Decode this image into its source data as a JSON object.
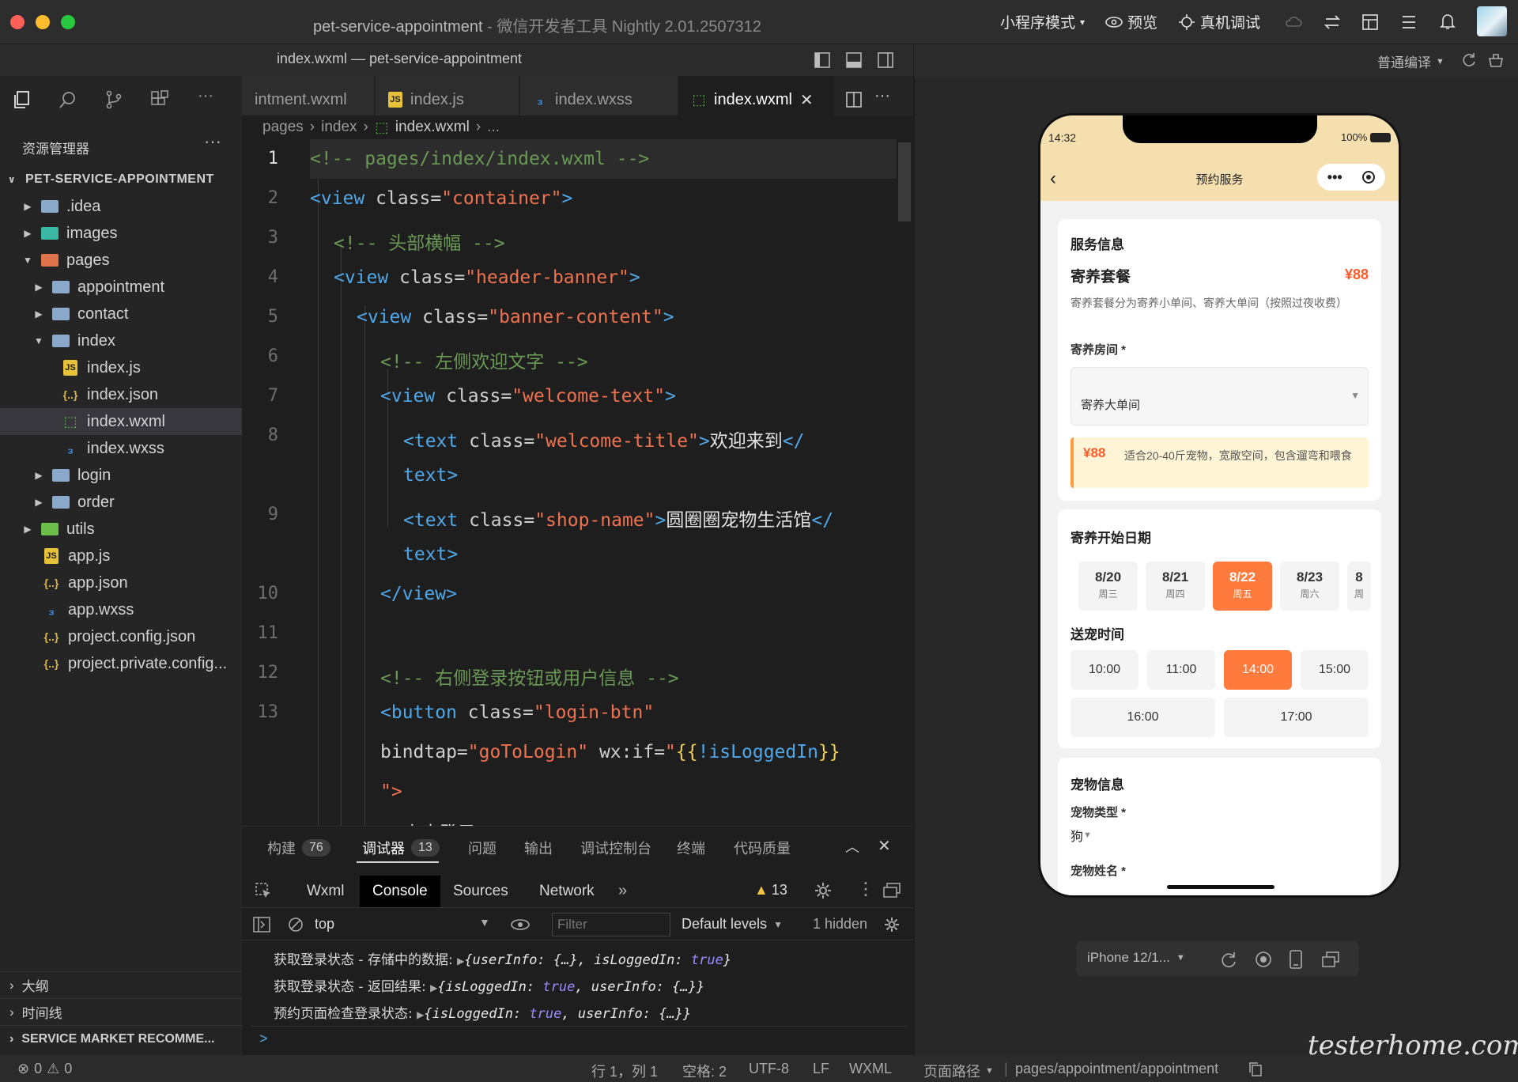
{
  "window": {
    "title": "pet-service-appointment",
    "subtitle": "- 微信开发者工具 Nightly 2.01.2507312",
    "mode_label": "小程序模式",
    "preview_label": "预览",
    "device_debug_label": "真机调试"
  },
  "editor_header": {
    "title": "index.wxml — pet-service-appointment"
  },
  "sim_header": {
    "compile_mode": "普通编译"
  },
  "tabs": [
    {
      "label": "intment.wxml",
      "icon": "wxml-file-icon"
    },
    {
      "label": "index.js",
      "icon": "js-file-icon"
    },
    {
      "label": "index.wxss",
      "icon": "wxss-file-icon"
    },
    {
      "label": "index.wxml",
      "icon": "wxml-file-icon",
      "active": true
    }
  ],
  "sidebar": {
    "title": "资源管理器",
    "root": "PET-SERVICE-APPOINTMENT",
    "items": [
      {
        "label": ".idea"
      },
      {
        "label": "images"
      },
      {
        "label": "pages"
      },
      {
        "label": "appointment"
      },
      {
        "label": "contact"
      },
      {
        "label": "index"
      },
      {
        "label": "index.js"
      },
      {
        "label": "index.json"
      },
      {
        "label": "index.wxml"
      },
      {
        "label": "index.wxss"
      },
      {
        "label": "login"
      },
      {
        "label": "order"
      },
      {
        "label": "utils"
      },
      {
        "label": "app.js"
      },
      {
        "label": "app.json"
      },
      {
        "label": "app.wxss"
      },
      {
        "label": "project.config.json"
      },
      {
        "label": "project.private.config..."
      }
    ],
    "bottom": [
      "大纲",
      "时间线",
      "SERVICE MARKET RECOMME..."
    ]
  },
  "breadcrumb": [
    "pages",
    "index",
    "index.wxml",
    "..."
  ],
  "code": {
    "line_numbers": [
      "1",
      "2",
      "3",
      "4",
      "5",
      "6",
      "7",
      "8",
      "9",
      "10",
      "11",
      "12",
      "13"
    ],
    "l1": "<!-- pages/index/index.wxml -->",
    "l2": [
      "<view",
      " class=",
      "\"container\"",
      ">"
    ],
    "l3": "<!-- 头部横幅 -->",
    "l4": [
      "<view",
      " class=",
      "\"header-banner\"",
      ">"
    ],
    "l5": [
      "<view",
      " class=",
      "\"banner-content\"",
      ">"
    ],
    "l6": "<!-- 左侧欢迎文字 -->",
    "l7": [
      "<view",
      " class=",
      "\"welcome-text\"",
      ">"
    ],
    "l8a": [
      "<text",
      " class=",
      "\"welcome-title\"",
      ">",
      "欢迎来到",
      "</"
    ],
    "l8b": "text>",
    "l9a": [
      "<text",
      " class=",
      "\"shop-name\"",
      ">",
      "圆圈圈宠物生活馆",
      "</"
    ],
    "l9b": "text>",
    "l10": "</view>",
    "l12": "<!-- 右侧登录按钮或用户信息 -->",
    "l13a": [
      "<button",
      " class=",
      "\"login-btn\""
    ],
    "l13b": [
      "bindtap=",
      "\"goToLogin\"",
      " wx:if=",
      "\"",
      "{{",
      "!isLoggedIn",
      "}}"
    ],
    "l13c": "\">",
    "l14": "点击登录"
  },
  "panel": {
    "tabs": [
      {
        "label": "构建",
        "count": "76"
      },
      {
        "label": "调试器",
        "count": "13"
      },
      {
        "label": "问题"
      },
      {
        "label": "输出"
      },
      {
        "label": "调试控制台"
      },
      {
        "label": "终端"
      },
      {
        "label": "代码质量"
      }
    ],
    "devtools_tabs": [
      "Wxml",
      "Console",
      "Sources",
      "Network"
    ],
    "warn_count": "13",
    "context": "top",
    "filter_placeholder": "Filter",
    "levels": "Default levels",
    "hidden": "1 hidden",
    "logs": [
      {
        "text": "获取登录状态 - 存储中的数据:",
        "obj": [
          "{userInfo: {…}, isLoggedIn: ",
          "true",
          "}"
        ]
      },
      {
        "text": "获取登录状态 - 返回结果:",
        "obj": [
          "{isLoggedIn: ",
          "true",
          ", userInfo: {…}}"
        ]
      },
      {
        "text": "预约页面检查登录状态:",
        "obj": [
          "{isLoggedIn: ",
          "true",
          ", userInfo: {…}}"
        ]
      }
    ],
    "prompt": ">"
  },
  "statusbar": {
    "errors": "0",
    "warnings": "0",
    "position": "行 1，列 1",
    "spaces": "空格: 2",
    "encoding": "UTF-8",
    "eol": "LF",
    "language": "WXML",
    "page_path_label": "页面路径",
    "page_path": "pages/appointment/appointment"
  },
  "phone": {
    "time": "14:32",
    "battery": "100%",
    "nav_title": "预约服务",
    "service_section": "服务信息",
    "package_name": "寄养套餐",
    "package_price": "¥88",
    "package_desc": "寄养套餐分为寄养小单间、寄养大单间（按照过夜收费）",
    "room_label": "寄养房间 *",
    "room_value": "寄养大单间",
    "room_price": "¥88",
    "room_desc": "适合20-40斤宠物，宽敞空间，包含遛弯和喂食",
    "date_section": "寄养开始日期",
    "dates": [
      {
        "d": "8/20",
        "w": "周三"
      },
      {
        "d": "8/21",
        "w": "周四"
      },
      {
        "d": "8/22",
        "w": "周五",
        "selected": true
      },
      {
        "d": "8/23",
        "w": "周六"
      },
      {
        "d": "8",
        "w": "周"
      }
    ],
    "time_section": "送宠时间",
    "times": [
      "10:00",
      "11:00",
      "14:00",
      "15:00",
      "16:00",
      "17:00"
    ],
    "selected_time": "14:00",
    "pet_section": "宠物信息",
    "pet_type_label": "宠物类型 *",
    "pet_type_value": "狗",
    "pet_name_label": "宠物姓名 *"
  },
  "sim_controls": {
    "device": "iPhone 12/1..."
  },
  "watermark": "testerhome.com",
  "colors": {
    "accent": "#ff7a3d",
    "price": "#ff5a2a",
    "nav_bg": "#f5dfaf"
  }
}
